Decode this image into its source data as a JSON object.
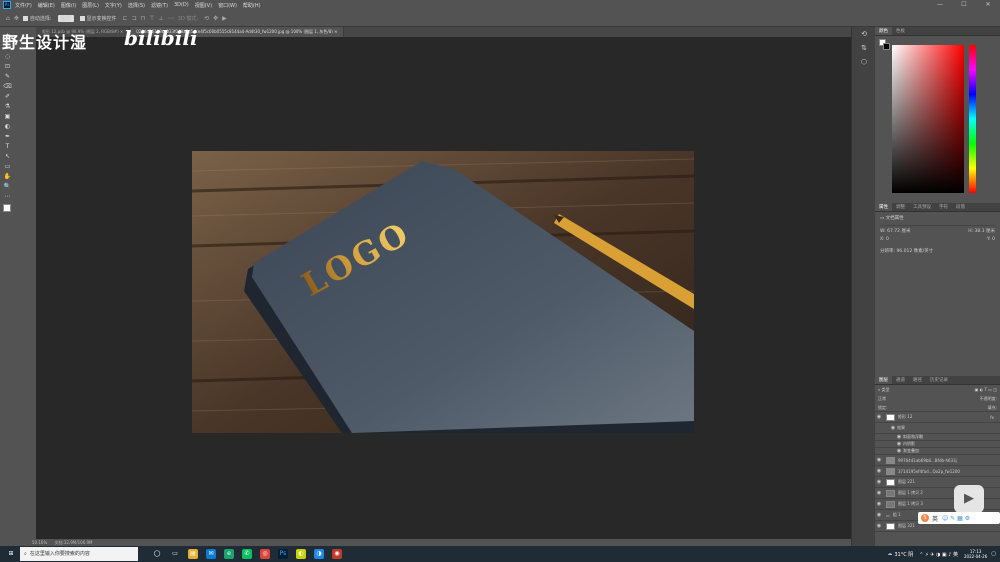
{
  "menubar": {
    "app_badge": "Ps",
    "items": [
      "文件(F)",
      "编辑(E)",
      "图像(I)",
      "图层(L)",
      "文字(Y)",
      "选择(S)",
      "滤镜(T)",
      "3D(D)",
      "视图(V)",
      "窗口(W)",
      "帮助(H)"
    ]
  },
  "window_controls": {
    "minimize": "—",
    "maximize": "☐",
    "close": "✕"
  },
  "options_bar": {
    "auto_select_label": "自动选择:",
    "auto_select_value": "图层",
    "show_transform_label": "显示变换控件",
    "mode_3d_label": "3D 模式:"
  },
  "tabs": [
    {
      "label": "矩形 12.psb @ 90.9% (图层 2, RGB/8#) ✕",
      "active": false
    },
    {
      "label": "029dd26108ca033f048a5d5dce4f5c00b0555c8144a4-Ad4t30_fw1200.jpg @ 100% (图层 1, 灰色/8) ✕",
      "active": true
    }
  ],
  "tools": [
    "✥",
    "⬚",
    "◌",
    "⊡",
    "✎",
    "⌫",
    "✐",
    "⚗",
    "▣",
    "◐",
    "✒",
    "T",
    "↖",
    "▭",
    "✋",
    "🔍",
    "⋯"
  ],
  "document": {
    "logo_text": "LOGO"
  },
  "status": {
    "zoom": "50.16%",
    "docsize": "文档:32.9M/106.9M"
  },
  "color_panel": {
    "tabs": [
      "颜色",
      "色板"
    ]
  },
  "properties_panel": {
    "tabs": [
      "属性",
      "调整",
      "工具预设",
      "字符",
      "段落"
    ],
    "doc_label": "文档属性",
    "w_label": "W:",
    "w_value": "67.72 厘米",
    "h_label": "H:",
    "h_value": "38.1 厘米",
    "x_label": "X:",
    "x_value": "0",
    "y_label": "Y:",
    "y_value": "0",
    "resolution_label": "分辨率: 96.012 像素/英寸"
  },
  "layers_panel": {
    "tabs": [
      "图层",
      "通道",
      "路径",
      "历史记录"
    ],
    "kind_label": "类型",
    "blend_mode": "正常",
    "opacity_label": "不透明度:",
    "lock_label": "锁定:",
    "fill_label": "填充:",
    "layers": [
      {
        "name": "矩形 12",
        "fx": "fx"
      },
      {
        "name": "效果"
      },
      {
        "name": "斜面和浮雕"
      },
      {
        "name": "内阴影"
      },
      {
        "name": "渐变叠加"
      },
      {
        "name": "9976441ab69b8...Bfdb-h633j"
      },
      {
        "name": "3714195ef4fad...Qo2p_fw1200"
      },
      {
        "name": "图层 221"
      },
      {
        "name": "图层 1 拷贝 2"
      },
      {
        "name": "图层 1 拷贝 3"
      },
      {
        "name": "组 1"
      },
      {
        "name": "图层 321"
      }
    ]
  },
  "taskbar": {
    "search_placeholder": "在这里输入你要搜索的内容",
    "weather": "31°C 阴",
    "time": "17:13",
    "date": "2022-04-26",
    "ime_label": "英"
  },
  "watermark": {
    "text": "野生设计湿",
    "brand": "bilibili"
  },
  "colors": {
    "accent": "#31a8ff",
    "panel": "#535353",
    "canvas": "#282828"
  }
}
